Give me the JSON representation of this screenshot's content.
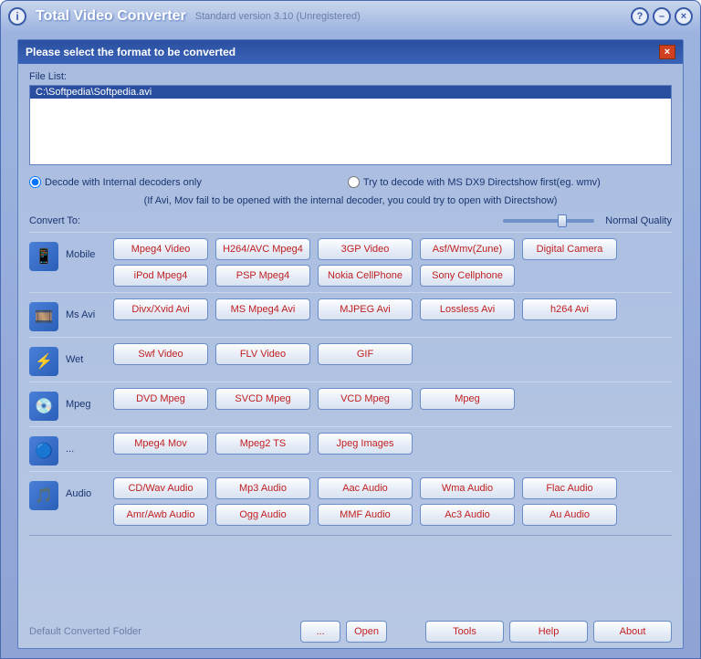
{
  "titlebar": {
    "info_glyph": "i",
    "title": "Total Video Converter",
    "subtitle": "Standard version 3.10 (Unregistered)",
    "help_glyph": "?",
    "minimize_glyph": "–",
    "close_glyph": "×"
  },
  "panel": {
    "header": "Please select the format to be converted",
    "close_glyph": "×",
    "file_list_label": "File List:",
    "files": [
      "C:\\Softpedia\\Softpedia.avi"
    ],
    "radio1": "Decode with Internal decoders only",
    "radio2": "Try to decode with MS DX9 Directshow first(eg. wmv)",
    "hint": "(If Avi, Mov fail to be opened with the internal decoder, you could try to open with Directshow)",
    "convert_label": "Convert To:",
    "quality_label": "Normal Quality"
  },
  "categories": [
    {
      "name": "Mobile",
      "icon": "📱",
      "buttons": [
        "Mpeg4 Video",
        "H264/AVC Mpeg4",
        "3GP Video",
        "Asf/Wmv(Zune)",
        "Digital Camera",
        "iPod Mpeg4",
        "PSP Mpeg4",
        "Nokia CellPhone",
        "Sony Cellphone"
      ]
    },
    {
      "name": "Ms Avi",
      "icon": "🎞️",
      "buttons": [
        "Divx/Xvid Avi",
        "MS Mpeg4 Avi",
        "MJPEG Avi",
        "Lossless Avi",
        "h264 Avi"
      ]
    },
    {
      "name": "Wet",
      "icon": "⚡",
      "buttons": [
        "Swf Video",
        "FLV Video",
        "GIF"
      ]
    },
    {
      "name": "Mpeg",
      "icon": "💿",
      "buttons": [
        "DVD Mpeg",
        "SVCD Mpeg",
        "VCD Mpeg",
        "Mpeg"
      ]
    },
    {
      "name": "...",
      "icon": "🔵",
      "buttons": [
        "Mpeg4 Mov",
        "Mpeg2 TS",
        "Jpeg Images"
      ]
    },
    {
      "name": "Audio",
      "icon": "🎵",
      "buttons": [
        "CD/Wav Audio",
        "Mp3 Audio",
        "Aac Audio",
        "Wma Audio",
        "Flac Audio",
        "Amr/Awb Audio",
        "Ogg  Audio",
        "MMF Audio",
        "Ac3 Audio",
        "Au  Audio"
      ]
    }
  ],
  "bottom": {
    "folder_label": "Default Converted Folder",
    "browse": "...",
    "open": "Open",
    "tools": "Tools",
    "help": "Help",
    "about": "About"
  }
}
